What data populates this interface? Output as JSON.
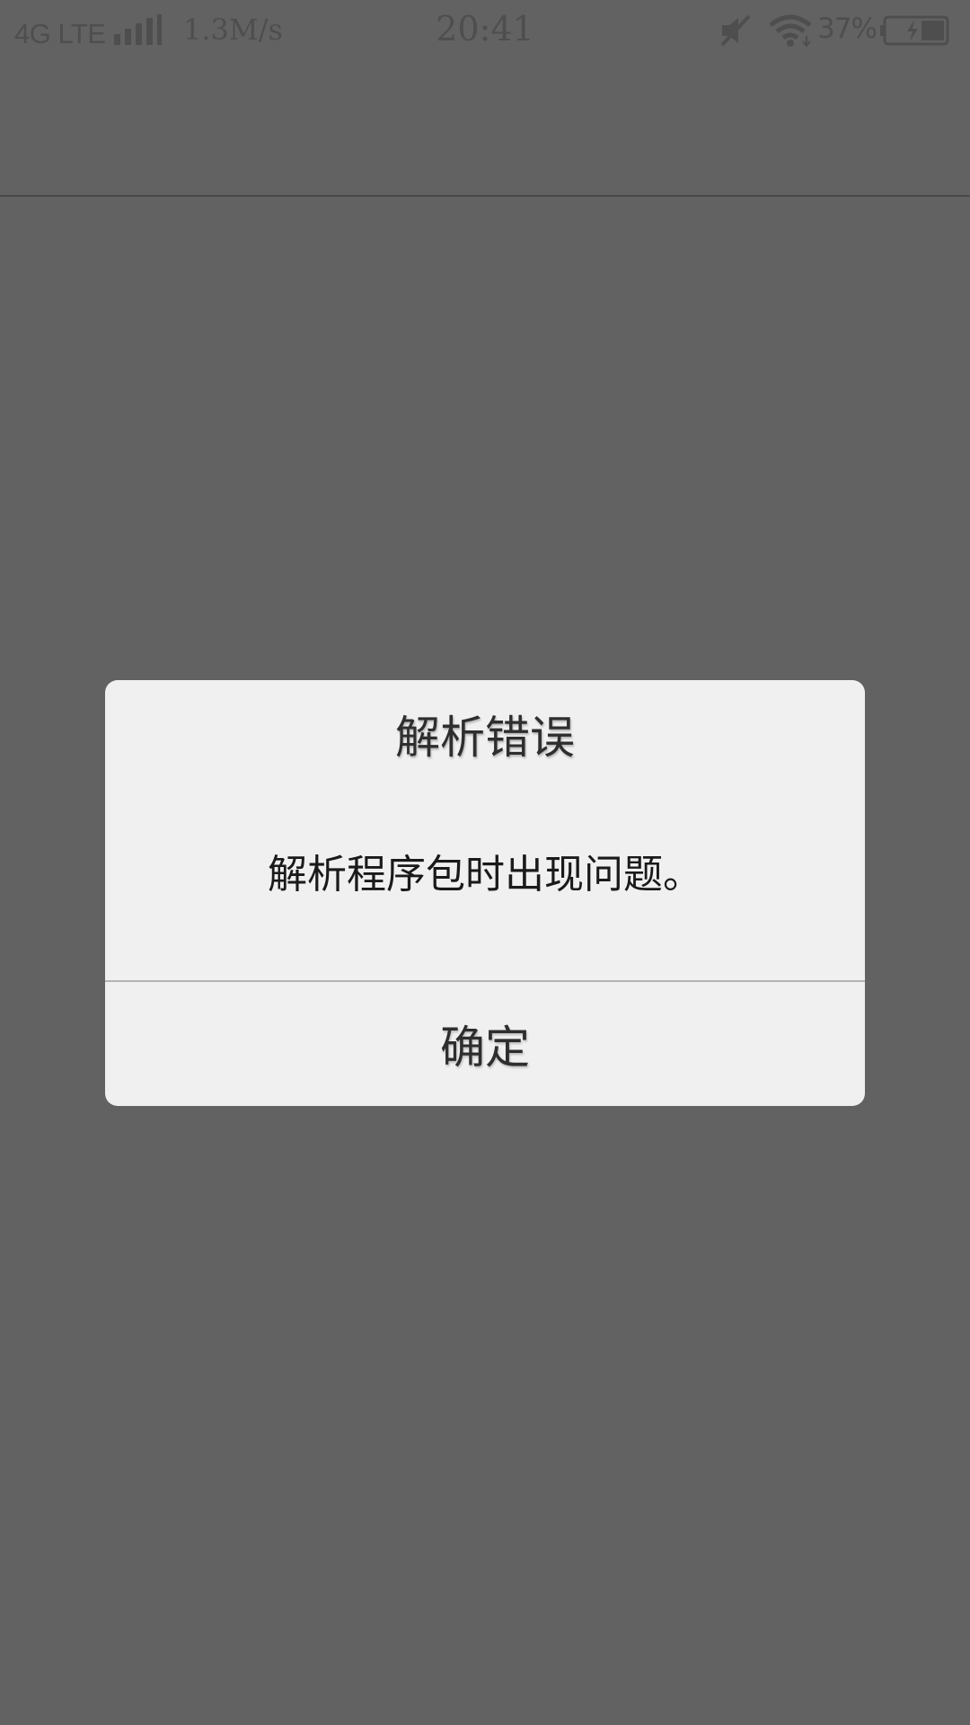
{
  "status_bar": {
    "network": "4G LTE",
    "speed": "1.3M/s",
    "time": "20:41",
    "battery_percent": "37%",
    "icons": [
      "signal-icon",
      "mute-icon",
      "wifi-icon",
      "battery-charging-icon"
    ]
  },
  "dialog": {
    "title": "解析错误",
    "message": "解析程序包时出现问题。",
    "confirm_label": "确定"
  },
  "colors": {
    "scrim": "#626262",
    "dialog_background": "#f0f0f0",
    "status_text": "#4e4e4e"
  }
}
